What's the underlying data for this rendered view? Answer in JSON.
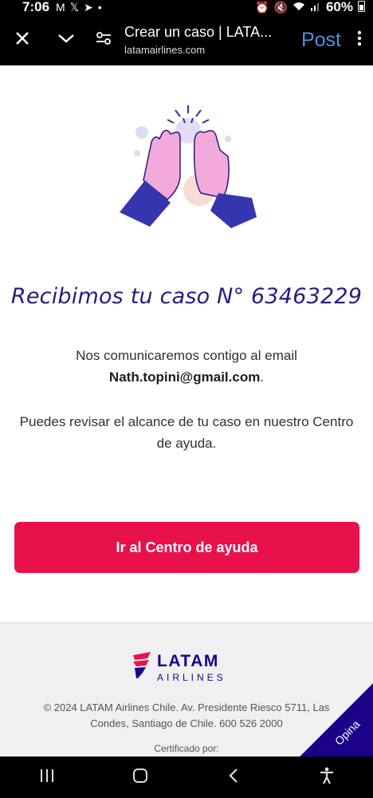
{
  "status_bar": {
    "time": "7:06",
    "notifications": [
      "M",
      "𝕏",
      "➤",
      "•"
    ],
    "battery": "60%"
  },
  "browser": {
    "tab_title": "Crear un caso | LATA...",
    "url": "latamairlines.com",
    "post_label": "Post"
  },
  "confirmation": {
    "headline": "Recibimos tu caso N° 63463229",
    "contact_prefix": "Nos comunicaremos contigo al email",
    "email": "Nath.topini@gmail.com",
    "email_suffix": ".",
    "review_text": "Puedes revisar el alcance de tu caso en nuestro Centro de ayuda.",
    "cta_label": "Ir al Centro de ayuda"
  },
  "footer": {
    "logo_main": "LATAM",
    "logo_sub": "AIRLINES",
    "copyright": "© 2024 LATAM Airlines Chile. Av. Presidente Riesco 5711, Las Condes, Santiago de Chile. 600 526 2000",
    "certified": "Certificado por:",
    "opina": "Opina"
  },
  "colors": {
    "brand_navy": "#1b0088",
    "brand_red": "#e8114b",
    "headline": "#2a1b7e"
  },
  "icons": {
    "close": "close-icon",
    "collapse": "chevron-down-icon",
    "site_settings": "tune-icon",
    "menu": "more-vert-icon",
    "nav_recents": "recents-icon",
    "nav_home": "home-icon",
    "nav_back": "back-icon",
    "nav_accessibility": "accessibility-icon"
  }
}
